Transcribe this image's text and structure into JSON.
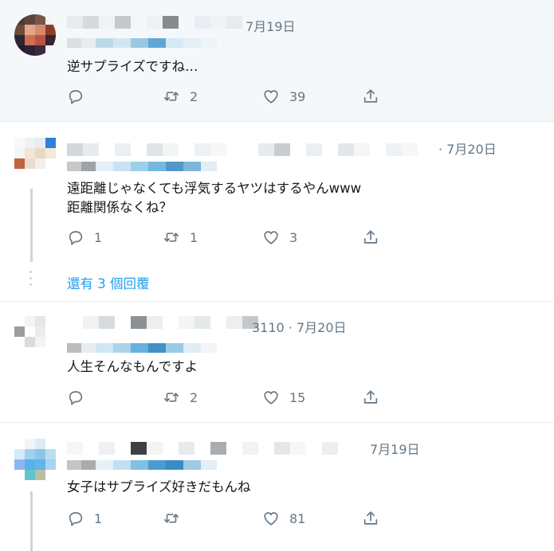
{
  "tweets": [
    {
      "date": "7月19日",
      "text": "逆サプライズですね…",
      "replies": "",
      "retweets": "2",
      "likes": "39"
    },
    {
      "date": "· 7月20日",
      "text": "遠距離じゃなくても浮気するヤツはするやんwww\n距離関係なくね？",
      "replies": "1",
      "retweets": "1",
      "likes": "3"
    },
    {
      "date": "3110 · 7月20日",
      "text": "人生そんなもんですよ",
      "replies": "",
      "retweets": "2",
      "likes": "15"
    },
    {
      "date": "7月19日",
      "text": "女子はサプライズ好きだもんね",
      "replies": "1",
      "retweets": "",
      "likes": "81"
    }
  ],
  "show_more": "還有 3 個回覆",
  "icons": [
    "reply-icon",
    "retweet-icon",
    "like-icon",
    "share-icon"
  ],
  "colors": {
    "link": "#1da1f2",
    "muted": "#657786",
    "highlight_bg": "#f5f8fa",
    "divider": "#e6ecf0"
  }
}
